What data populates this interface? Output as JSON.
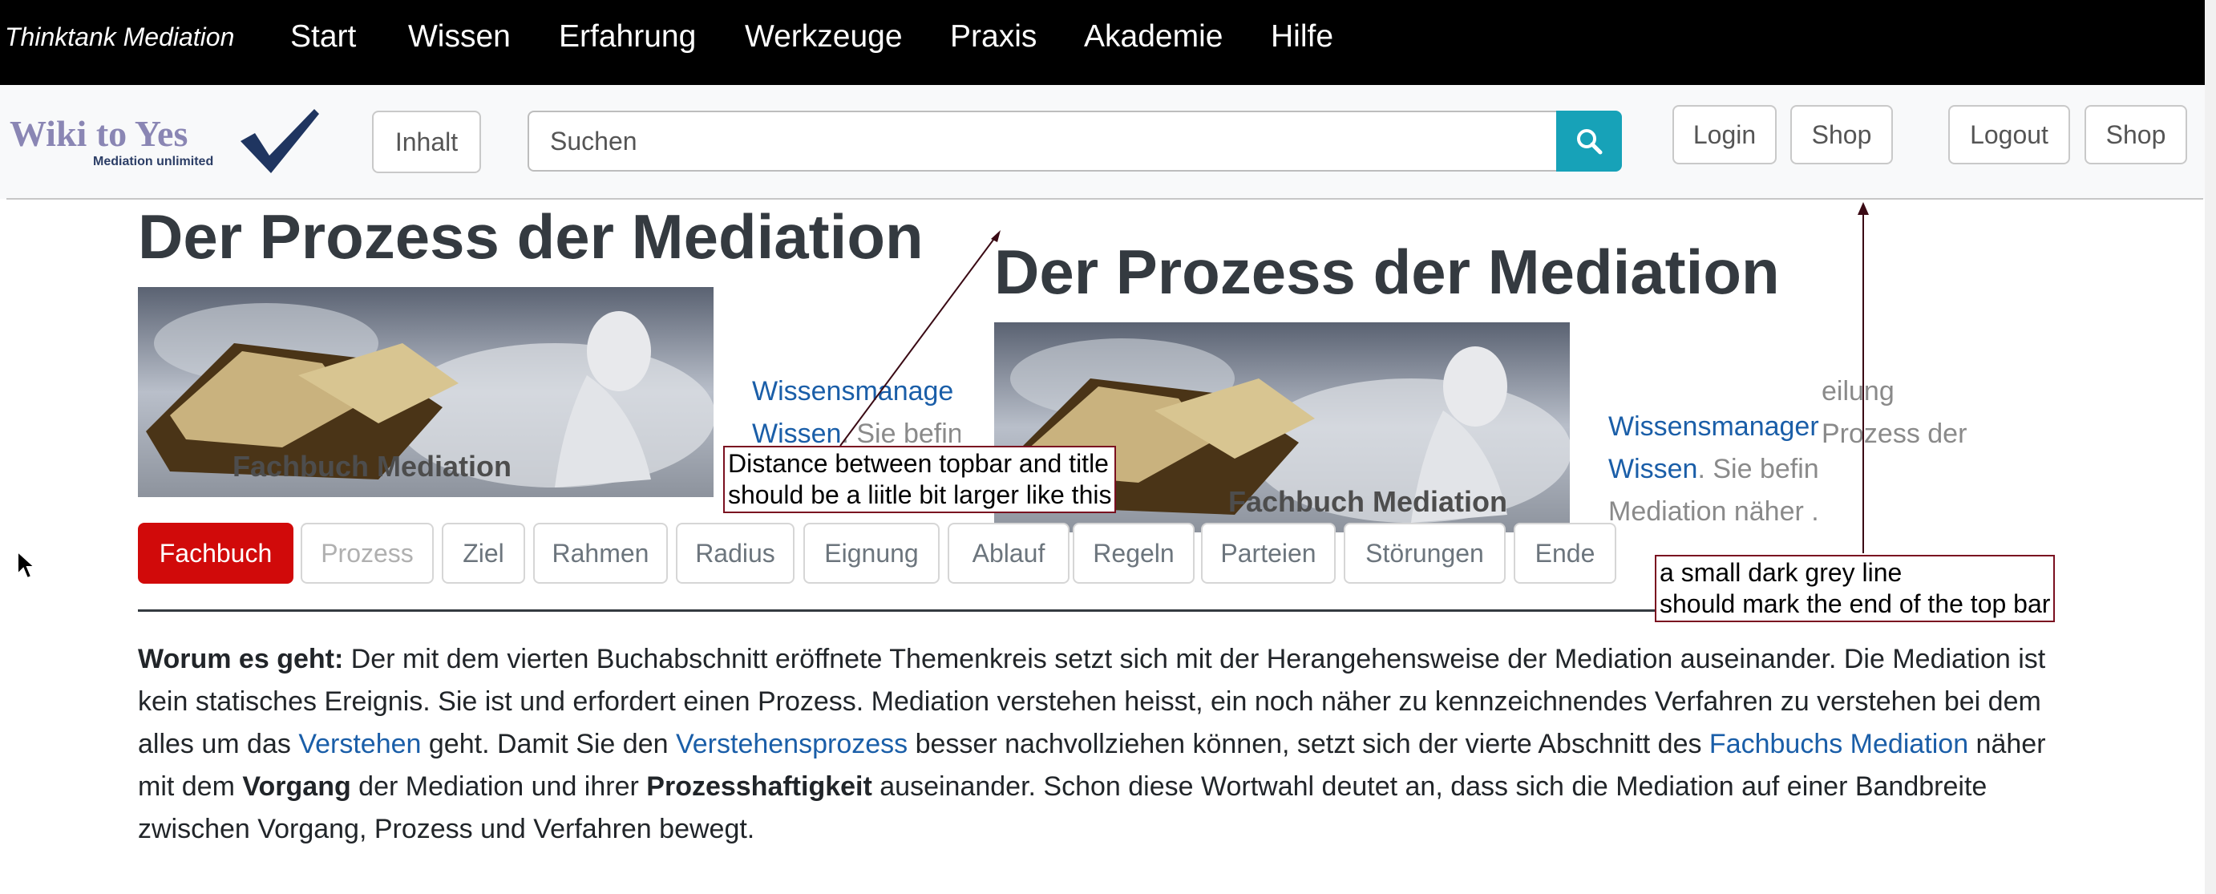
{
  "topbar": {
    "brand": "Thinktank Mediation",
    "nav": [
      "Start",
      "Wissen",
      "Erfahrung",
      "Werkzeuge",
      "Praxis",
      "Akademie",
      "Hilfe"
    ]
  },
  "header": {
    "logo_text": "Wiki to Yes",
    "logo_subtitle": "Mediation unlimited",
    "contents_button": "Inhalt",
    "search_placeholder": "Suchen",
    "left_buttons": [
      "Login",
      "Shop"
    ],
    "right_buttons": [
      "Logout",
      "Shop"
    ]
  },
  "page": {
    "title": "Der Prozess der Mediation",
    "book_caption": "Fachbuch Mediation",
    "left_fragment": {
      "line1_link": "Wissensmanage",
      "line2_link": "Wissen",
      "line2_text": ". Sie befin"
    },
    "right_fragment": {
      "line0_text": "eilung",
      "line1_link": "Wissensmanager",
      "line1_text": "Prozess der",
      "line2_link": "Wissen",
      "line2_text": ". Sie befin",
      "line3_text": "Mediation näher ."
    },
    "tabs": [
      "Fachbuch",
      "Prozess",
      "Ziel",
      "Rahmen",
      "Radius",
      "Eignung",
      "Ablauf",
      "Regeln",
      "Parteien",
      "Störungen",
      "Ende"
    ],
    "paragraph": {
      "lead": "Worum es geht:",
      "t1": " Der mit dem vierten Buchabschnitt eröffnete Themenkreis setzt sich mit der Herangehensweise der Mediation auseinander. Die Mediation ist kein statisches Ereignis. Sie ist und erfordert einen Prozess. Mediation verstehen heisst, ein noch näher zu kennzeichnendes Verfahren zu verstehen bei dem alles um das ",
      "link1": "Verstehen",
      "t2": " geht. Damit Sie den ",
      "link2": "Verstehensprozess",
      "t3": " besser nachvollziehen können, setzt sich der vierte Abschnitt des ",
      "link3": "Fachbuchs Mediation",
      "t4": " näher mit dem ",
      "bold1": "Vorgang",
      "t5": " der Mediation und ihrer ",
      "bold2": "Prozesshaftigkeit",
      "t6": " auseinander. Schon diese Wortwahl deutet an, dass sich die Mediation auf einer Bandbreite zwischen Vorgang, Prozess und Verfahren bewegt."
    }
  },
  "annotations": {
    "note1_line1": "Distance between topbar and title",
    "note1_line2": "should be a liitle bit larger like this",
    "note2_line1": "a small dark grey line",
    "note2_line2": "should mark the end of the top bar"
  },
  "colors": {
    "topbar": "#000000",
    "search_button": "#17a2b8",
    "active_tab": "#d10a0a",
    "link": "#1a5ea8",
    "annotation_border": "#7a1020"
  }
}
